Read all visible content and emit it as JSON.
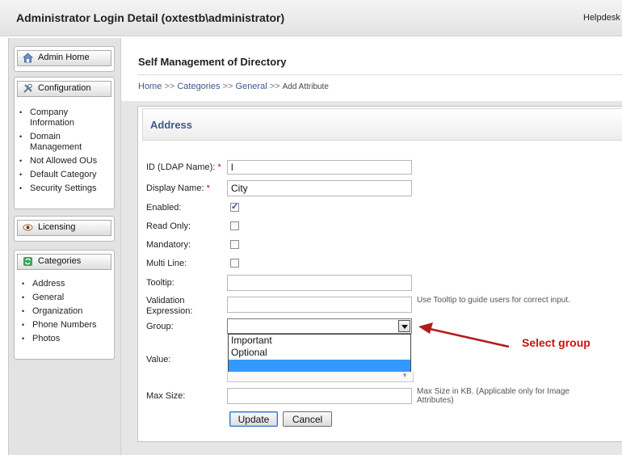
{
  "header": {
    "title": "Administrator Login Detail (oxtestb\\administrator)",
    "help_link": "Helpdesk"
  },
  "sidebar": {
    "admin_home": {
      "label": "Admin Home",
      "icon": "house-icon"
    },
    "configuration": {
      "label": "Configuration",
      "icon": "tools-icon",
      "items": [
        "Company Information",
        "Domain Management",
        "Not Allowed OUs",
        "Default Category",
        "Security Settings"
      ]
    },
    "licensing": {
      "label": "Licensing",
      "icon": "eye-icon"
    },
    "categories": {
      "label": "Categories",
      "icon": "refresh-icon",
      "items": [
        "Address",
        "General",
        "Organization",
        "Phone Numbers",
        "Photos"
      ]
    }
  },
  "main": {
    "title": "Self Management of Directory",
    "breadcrumb": {
      "items": [
        "Home",
        "Categories",
        "General"
      ],
      "separator": ">>",
      "current": "Add Attribute"
    },
    "section_title": "Address"
  },
  "form": {
    "id_label": "ID (LDAP Name):",
    "id_value": "l",
    "display_name_label": "Display Name:",
    "display_name_value": "City",
    "required_mark": "*",
    "enabled_label": "Enabled:",
    "enabled_checked": true,
    "read_only_label": "Read Only:",
    "read_only_checked": false,
    "mandatory_label": "Mandatory:",
    "mandatory_checked": false,
    "multi_line_label": "Multi Line:",
    "multi_line_checked": false,
    "tooltip_label": "Tooltip:",
    "tooltip_value": "",
    "tooltip_hint": "Use Tooltip to guide users for correct input.",
    "validation_label": "Validation Expression:",
    "validation_value": "",
    "group_label": "Group:",
    "group_value": "",
    "group_options": [
      "Important",
      "Optional",
      ""
    ],
    "value_label": "Value:",
    "max_size_label": "Max Size:",
    "max_size_value": "",
    "max_size_hint": "Max Size in KB. (Applicable only for Image Attributes)",
    "update_label": "Update",
    "cancel_label": "Cancel"
  },
  "annotation": {
    "text": "Select group",
    "color": "#cc1111"
  }
}
